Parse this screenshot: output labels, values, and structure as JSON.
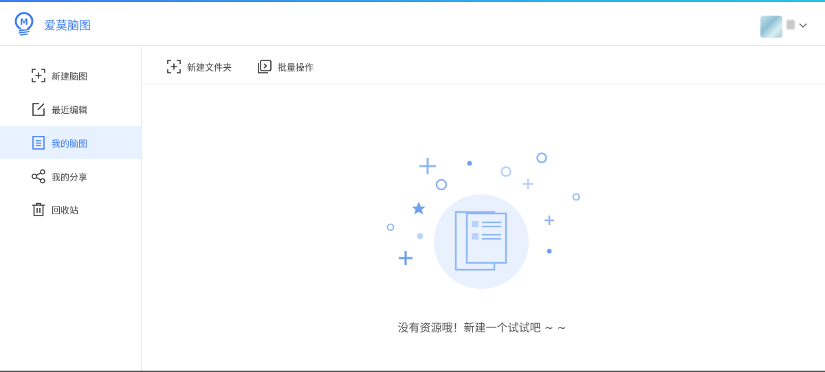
{
  "app": {
    "brand": "爱莫脑图",
    "logo_letter": "M"
  },
  "colors": {
    "accent": "#3d7cf4",
    "active_bg": "#e8f1ff",
    "illustration": "#8fb6f5"
  },
  "header": {
    "user_menu_icon": "chevron-down-icon"
  },
  "sidebar": {
    "items": [
      {
        "label": "新建脑图",
        "icon": "add-frame-icon",
        "active": false
      },
      {
        "label": "最近编辑",
        "icon": "edit-icon",
        "active": false
      },
      {
        "label": "我的脑图",
        "icon": "document-icon",
        "active": true
      },
      {
        "label": "我的分享",
        "icon": "share-icon",
        "active": false
      },
      {
        "label": "回收站",
        "icon": "trash-icon",
        "active": false
      }
    ]
  },
  "toolbar": {
    "new_folder": "新建文件夹",
    "batch": "批量操作"
  },
  "empty_state": {
    "message": "没有资源哦！新建一个试试吧 ~ ~",
    "icon": "empty-documents-illustration"
  }
}
